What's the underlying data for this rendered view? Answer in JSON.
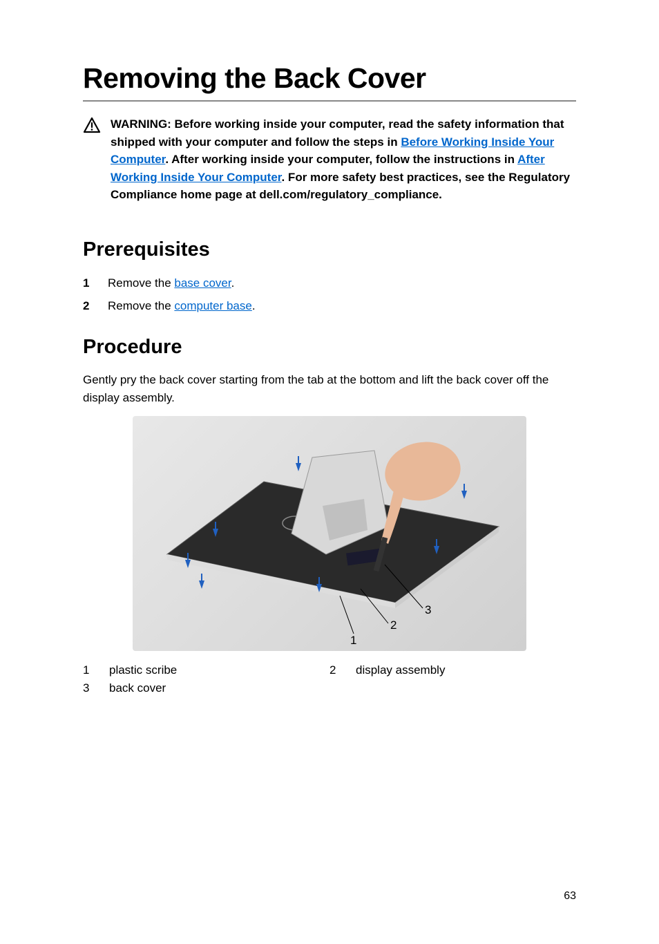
{
  "title": "Removing the Back Cover",
  "warning": {
    "prefix": "WARNING: Before working inside your computer, read the safety information that shipped with your computer and follow the steps in ",
    "link1": "Before Working Inside Your Computer",
    "mid1": ". After working inside your computer, follow the instructions in ",
    "link2": "After Working Inside Your Computer",
    "suffix": ". For more safety best practices, see the Regulatory Compliance home page at dell.com/regulatory_compliance."
  },
  "prerequisites": {
    "heading": "Prerequisites",
    "items": [
      {
        "num": "1",
        "prefix": "Remove the ",
        "link": "base cover",
        "suffix": "."
      },
      {
        "num": "2",
        "prefix": "Remove the ",
        "link": "computer base",
        "suffix": "."
      }
    ]
  },
  "procedure": {
    "heading": "Procedure",
    "text": "Gently pry the back cover starting from the tab at the bottom and lift the back cover off the display assembly."
  },
  "figure": {
    "alt": "Illustration: prying back cover from display assembly with plastic scribe, callouts 1, 2, 3"
  },
  "callouts": [
    {
      "num": "1",
      "label": "plastic scribe"
    },
    {
      "num": "2",
      "label": "display assembly"
    },
    {
      "num": "3",
      "label": "back cover"
    }
  ],
  "page_number": "63"
}
